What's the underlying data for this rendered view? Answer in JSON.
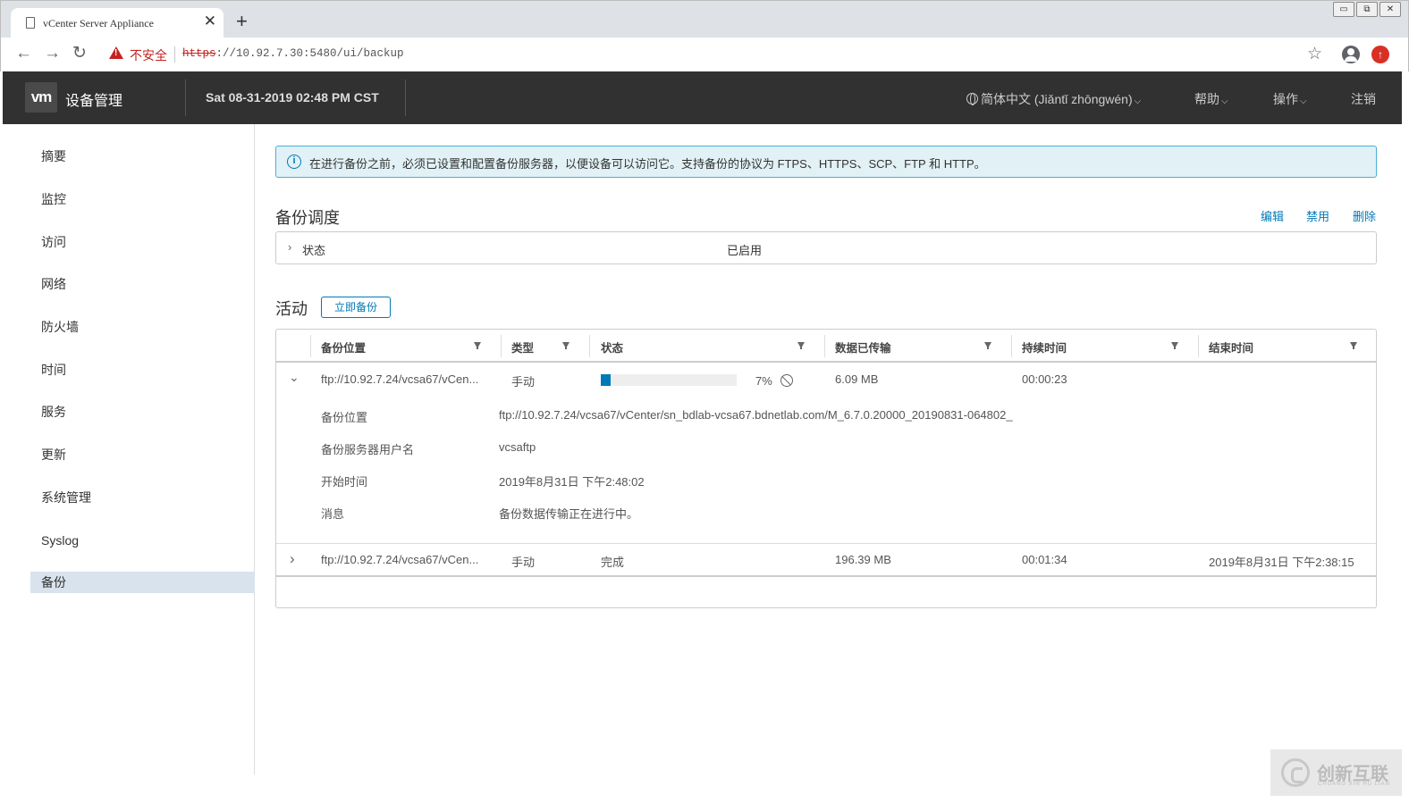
{
  "browser": {
    "tab_title": "vCenter Server Appliance",
    "tab_close": "✕",
    "new_tab": "+",
    "insecure_label": "不安全",
    "url_scheme": "https",
    "url_rest": "://10.92.7.30:5480/ui/backup",
    "win_minimize": "▭",
    "win_restore": "⧉",
    "win_close": "✕"
  },
  "header": {
    "logo": "vm",
    "app_title": "设备管理",
    "datetime": "Sat 08-31-2019 02:48 PM CST",
    "language": "简体中文 (Jiǎntǐ zhōngwén)",
    "help": "帮助",
    "actions": "操作",
    "logout": "注销"
  },
  "sidebar": {
    "items": [
      "摘要",
      "监控",
      "访问",
      "网络",
      "防火墙",
      "时间",
      "服务",
      "更新",
      "系统管理",
      "Syslog",
      "备份"
    ],
    "active_index": 10
  },
  "banner": {
    "text": "在进行备份之前，必须已设置和配置备份服务器，以便设备可以访问它。支持备份的协议为 FTPS、HTTPS、SCP、FTP 和 HTTP。"
  },
  "schedule": {
    "title": "备份调度",
    "edit": "编辑",
    "disable": "禁用",
    "delete": "删除",
    "status_label": "状态",
    "status_value": "已启用"
  },
  "activity": {
    "title": "活动",
    "backup_now": "立即备份",
    "columns": [
      "备份位置",
      "类型",
      "状态",
      "数据已传输",
      "持续时间",
      "结束时间"
    ],
    "rows": [
      {
        "location": "ftp://10.92.7.24/vcsa67/vCen...",
        "type": "手动",
        "progress_percent": 7,
        "progress_label": "7%",
        "transferred": "6.09 MB",
        "duration": "00:00:23",
        "end_time": "",
        "expanded": true,
        "details": [
          {
            "label": "备份位置",
            "value": "ftp://10.92.7.24/vcsa67/vCenter/sn_bdlab-vcsa67.bdnetlab.com/M_6.7.0.20000_20190831-064802_"
          },
          {
            "label": "备份服务器用户名",
            "value": "vcsaftp"
          },
          {
            "label": "开始时间",
            "value": "2019年8月31日 下午2:48:02"
          },
          {
            "label": "消息",
            "value": "备份数据传输正在进行中。"
          }
        ]
      },
      {
        "location": "ftp://10.92.7.24/vcsa67/vCen...",
        "type": "手动",
        "status": "完成",
        "transferred": "196.39 MB",
        "duration": "00:01:34",
        "end_time": "2019年8月31日 下午2:38:15",
        "expanded": false
      }
    ]
  },
  "watermark": {
    "text": "创新互联",
    "sub": "CHUANG XIN HU LIAN"
  },
  "colors": {
    "header_bg": "#313131",
    "accent": "#0079b8",
    "banner_bg": "#e1f1f6",
    "sidebar_active": "#d8e3ed",
    "insecure": "#c5221f"
  }
}
